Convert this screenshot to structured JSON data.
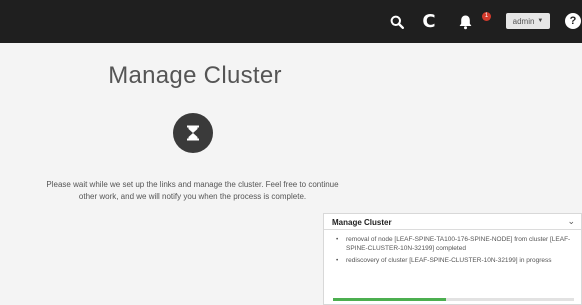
{
  "header": {
    "user": "admin",
    "notification_count": "1",
    "help_glyph": "?",
    "refresh_glyph": "C"
  },
  "main": {
    "title": "Manage Cluster",
    "wait_message_line1": "Please wait while we set up the links and manage the cluster. Feel free to continue",
    "wait_message_line2": "other work, and we will notify you when the process is complete."
  },
  "notification_panel": {
    "title": "Manage Cluster",
    "collapse_glyph": "⌄",
    "items": [
      "removal of node [LEAF-SPINE-TA100-176-SPINE-NODE] from cluster [LEAF-SPINE-CLUSTER-10N-32199] completed",
      "rediscovery of cluster [LEAF-SPINE-CLUSTER-10N-32199] in progress"
    ],
    "progress": 0.47
  },
  "colors": {
    "topbar": "#1f1f1f",
    "badge": "#d43a2c",
    "progress": "#4caf50"
  }
}
